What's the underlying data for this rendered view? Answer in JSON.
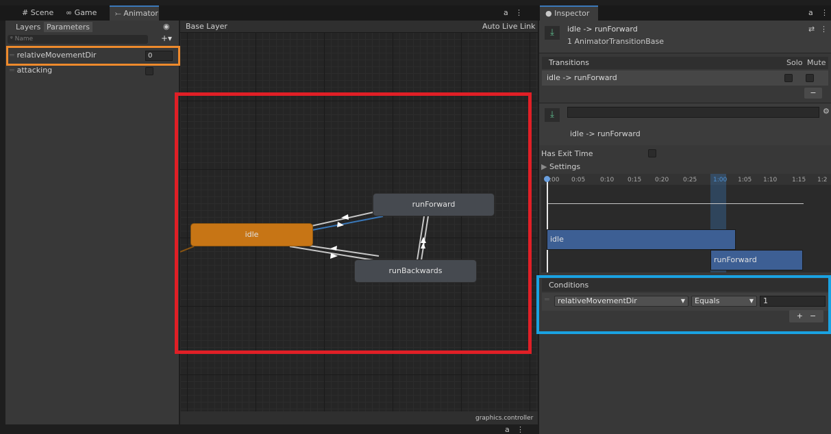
{
  "tabs": [
    {
      "icon": "#",
      "label": "Scene"
    },
    {
      "icon": "∞",
      "label": "Game"
    },
    {
      "icon": "⤚",
      "label": "Animator"
    }
  ],
  "inspector_tab": {
    "icon": "●",
    "label": "Inspector"
  },
  "lock_glyph": "a",
  "menu_glyph": "⋮",
  "left_panel": {
    "subtabs": [
      "Layers",
      "Parameters"
    ],
    "search_placeholder": "Name",
    "add_label": "+▾",
    "parameters": [
      {
        "name": "relativeMovementDir",
        "value": "0",
        "type": "int"
      },
      {
        "name": "attacking",
        "value": false,
        "type": "bool"
      }
    ]
  },
  "graph": {
    "eye_icon": "eye-icon",
    "breadcrumb": "Base Layer",
    "auto_live_link": "Auto Live Link",
    "footer": "graphics.controller",
    "states": {
      "idle": "idle",
      "runForward": "runForward",
      "runBackwards": "runBackwards"
    }
  },
  "inspector": {
    "title": "idle -> runForward",
    "subtitle": "1 AnimatorTransitionBase",
    "transitions_header": "Transitions",
    "solo": "Solo",
    "mute": "Mute",
    "transition_row": "idle -> runForward",
    "minus": "−",
    "plus": "+",
    "name_field_value": "",
    "detail_label": "idle -> runForward",
    "has_exit_time": "Has Exit Time",
    "settings": "Settings",
    "timeline_ticks": [
      ":00",
      "0:05",
      "0:10",
      "0:15",
      "0:20",
      "0:25",
      "1:00",
      "1:05",
      "1:10",
      "1:15",
      "1:2"
    ],
    "timeline_clips": {
      "from": "idle",
      "to": "runForward"
    },
    "conditions_header": "Conditions",
    "condition": {
      "parameter": "relativeMovementDir",
      "operator": "Equals",
      "value": "1"
    }
  },
  "colors": {
    "state_default": "#464a50",
    "state_entry": "#c77515",
    "transition_selected": "#3a79bb",
    "highlight_orange": "#ee8a2c",
    "highlight_red": "#e01f26",
    "highlight_blue": "#1aa2e2"
  }
}
